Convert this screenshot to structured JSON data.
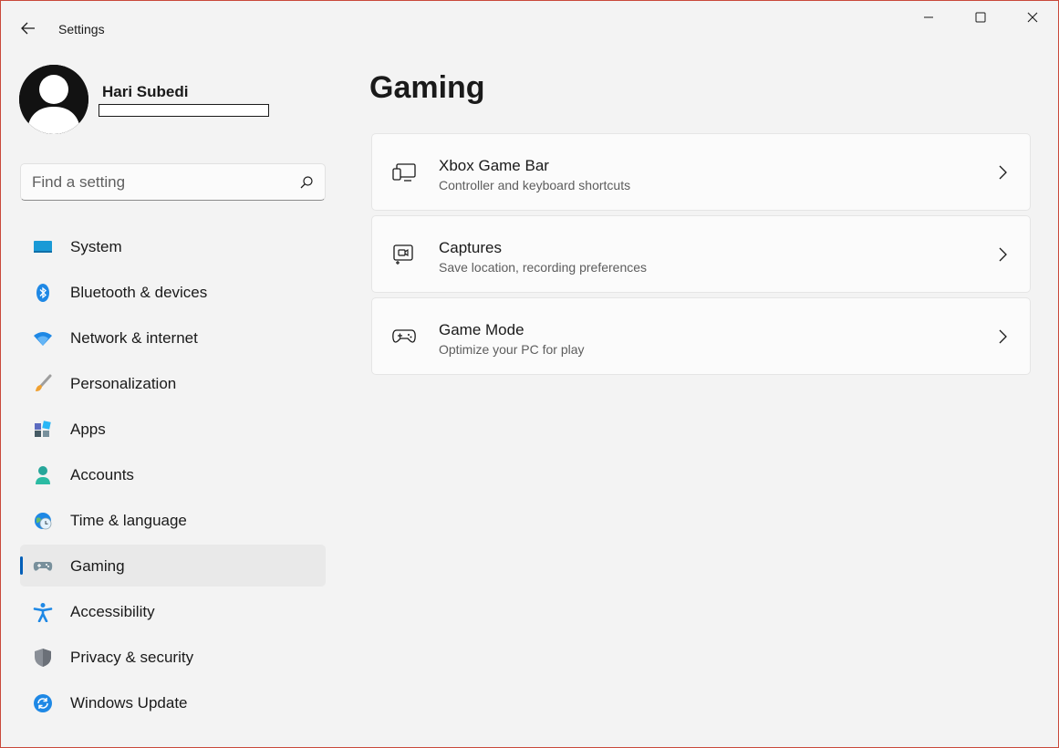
{
  "window": {
    "title": "Settings",
    "controls": [
      "minimize",
      "maximize",
      "close"
    ]
  },
  "profile": {
    "name": "Hari Subedi",
    "email": ""
  },
  "search": {
    "placeholder": "Find a setting",
    "value": ""
  },
  "sidebar": {
    "items": [
      {
        "label": "System",
        "icon": "display-icon",
        "active": false
      },
      {
        "label": "Bluetooth & devices",
        "icon": "bluetooth-icon",
        "active": false
      },
      {
        "label": "Network & internet",
        "icon": "wifi-icon",
        "active": false
      },
      {
        "label": "Personalization",
        "icon": "brush-icon",
        "active": false
      },
      {
        "label": "Apps",
        "icon": "apps-icon",
        "active": false
      },
      {
        "label": "Accounts",
        "icon": "person-icon",
        "active": false
      },
      {
        "label": "Time & language",
        "icon": "globe-clock-icon",
        "active": false
      },
      {
        "label": "Gaming",
        "icon": "gamepad-icon",
        "active": true
      },
      {
        "label": "Accessibility",
        "icon": "accessibility-icon",
        "active": false
      },
      {
        "label": "Privacy & security",
        "icon": "shield-icon",
        "active": false
      },
      {
        "label": "Windows Update",
        "icon": "update-icon",
        "active": false
      }
    ]
  },
  "main": {
    "title": "Gaming",
    "cards": [
      {
        "title": "Xbox Game Bar",
        "subtitle": "Controller and keyboard shortcuts",
        "icon": "game-bar-icon"
      },
      {
        "title": "Captures",
        "subtitle": "Save location, recording preferences",
        "icon": "capture-icon"
      },
      {
        "title": "Game Mode",
        "subtitle": "Optimize your PC for play",
        "icon": "game-mode-icon"
      }
    ]
  },
  "colors": {
    "accent": "#005fb8",
    "background": "#f3f3f3",
    "card": "#fbfbfb",
    "window_border": "#c9493b"
  }
}
